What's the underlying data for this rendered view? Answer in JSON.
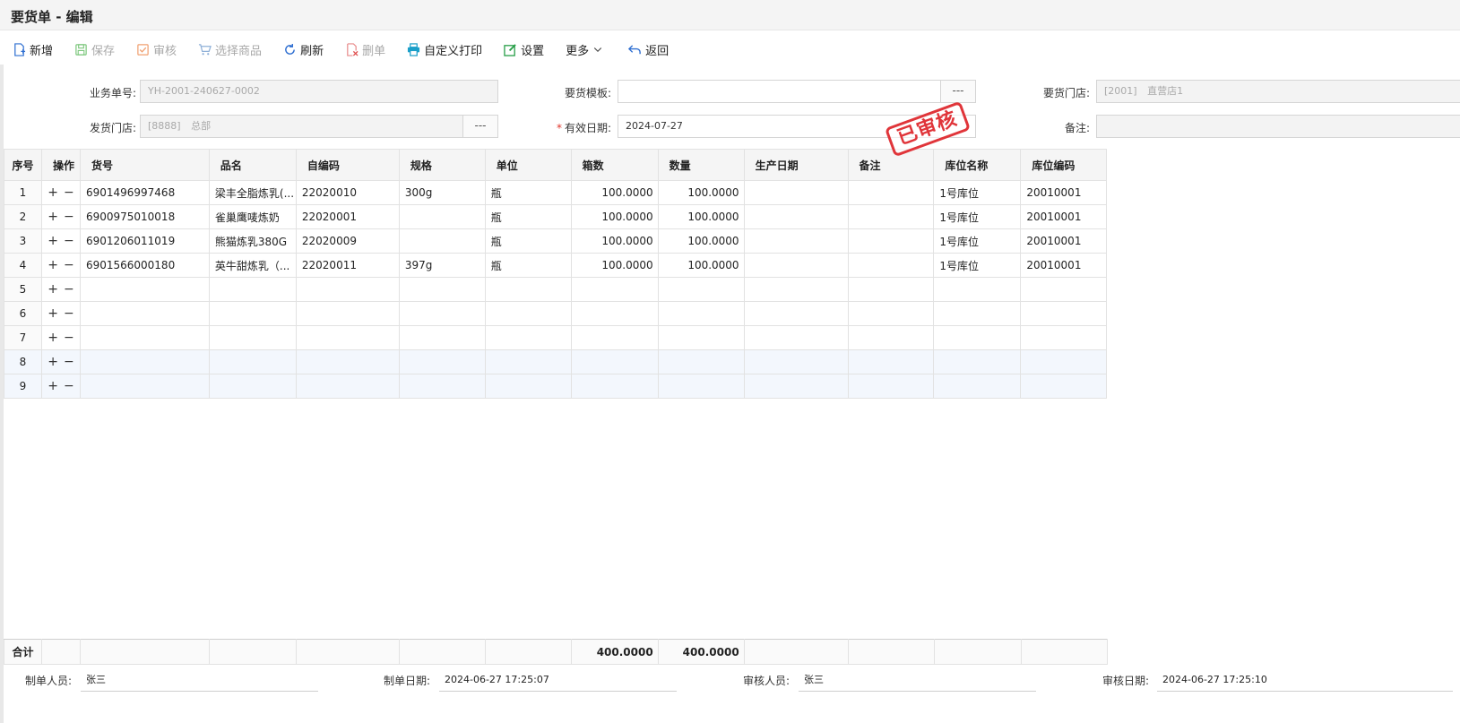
{
  "window": {
    "title": "要货单 - 编辑"
  },
  "toolbar": {
    "add": "新增",
    "save": "保存",
    "audit": "审核",
    "select_goods": "选择商品",
    "refresh": "刷新",
    "delete": "删单",
    "print": "自定义打印",
    "settings": "设置",
    "more": "更多",
    "back": "返回"
  },
  "form": {
    "bill_no_label": "业务单号:",
    "bill_no": "YH-2001-240627-0002",
    "template_label": "要货模板:",
    "template": "",
    "req_store_label": "要货门店:",
    "req_store_code": "[2001]",
    "req_store_name": "直营店1",
    "ship_store_label": "发货门店:",
    "ship_store_code": "[8888]",
    "ship_store_name": "总部",
    "valid_date_label": "有效日期:",
    "valid_date": "2024-07-27",
    "remark_label": "备注:",
    "remark": "",
    "dots": "---",
    "required_mark": "*"
  },
  "stamp": {
    "text": "已审核",
    "color": "#e0353a"
  },
  "grid": {
    "headers": [
      "序号",
      "操作",
      "货号",
      "品名",
      "自编码",
      "规格",
      "单位",
      "箱数",
      "数量",
      "生产日期",
      "备注",
      "库位名称",
      "库位编码"
    ],
    "rows": [
      {
        "seq": "1",
        "code": "6901496997468",
        "name": "梁丰全脂炼乳(...",
        "selfcode": "22020010",
        "spec": "300g",
        "unit": "瓶",
        "boxes": "100.0000",
        "qty": "100.0000",
        "date": "",
        "remark": "",
        "loc_name": "1号库位",
        "loc_code": "20010001"
      },
      {
        "seq": "2",
        "code": "6900975010018",
        "name": "雀巢鹰唛炼奶",
        "selfcode": "22020001",
        "spec": "",
        "unit": "瓶",
        "boxes": "100.0000",
        "qty": "100.0000",
        "date": "",
        "remark": "",
        "loc_name": "1号库位",
        "loc_code": "20010001"
      },
      {
        "seq": "3",
        "code": "6901206011019",
        "name": "熊猫炼乳380G",
        "selfcode": "22020009",
        "spec": "",
        "unit": "瓶",
        "boxes": "100.0000",
        "qty": "100.0000",
        "date": "",
        "remark": "",
        "loc_name": "1号库位",
        "loc_code": "20010001"
      },
      {
        "seq": "4",
        "code": "6901566000180",
        "name": "英牛甜炼乳（...",
        "selfcode": "22020011",
        "spec": "397g",
        "unit": "瓶",
        "boxes": "100.0000",
        "qty": "100.0000",
        "date": "",
        "remark": "",
        "loc_name": "1号库位",
        "loc_code": "20010001"
      },
      {
        "seq": "5",
        "code": "",
        "name": "",
        "selfcode": "",
        "spec": "",
        "unit": "",
        "boxes": "",
        "qty": "",
        "date": "",
        "remark": "",
        "loc_name": "",
        "loc_code": ""
      },
      {
        "seq": "6",
        "code": "",
        "name": "",
        "selfcode": "",
        "spec": "",
        "unit": "",
        "boxes": "",
        "qty": "",
        "date": "",
        "remark": "",
        "loc_name": "",
        "loc_code": ""
      },
      {
        "seq": "7",
        "code": "",
        "name": "",
        "selfcode": "",
        "spec": "",
        "unit": "",
        "boxes": "",
        "qty": "",
        "date": "",
        "remark": "",
        "loc_name": "",
        "loc_code": ""
      },
      {
        "seq": "8",
        "code": "",
        "name": "",
        "selfcode": "",
        "spec": "",
        "unit": "",
        "boxes": "",
        "qty": "",
        "date": "",
        "remark": "",
        "loc_name": "",
        "loc_code": ""
      },
      {
        "seq": "9",
        "code": "",
        "name": "",
        "selfcode": "",
        "spec": "",
        "unit": "",
        "boxes": "",
        "qty": "",
        "date": "",
        "remark": "",
        "loc_name": "",
        "loc_code": ""
      }
    ],
    "ops_add": "+",
    "ops_remove": "−",
    "sum_label": "合计",
    "sum_boxes": "400.0000",
    "sum_qty": "400.0000"
  },
  "footer": {
    "creator_label": "制单人员:",
    "creator": "张三",
    "create_date_label": "制单日期:",
    "create_date": "2024-06-27 17:25:07",
    "auditor_label": "审核人员:",
    "auditor": "张三",
    "audit_date_label": "审核日期:",
    "audit_date": "2024-06-27 17:25:10"
  }
}
